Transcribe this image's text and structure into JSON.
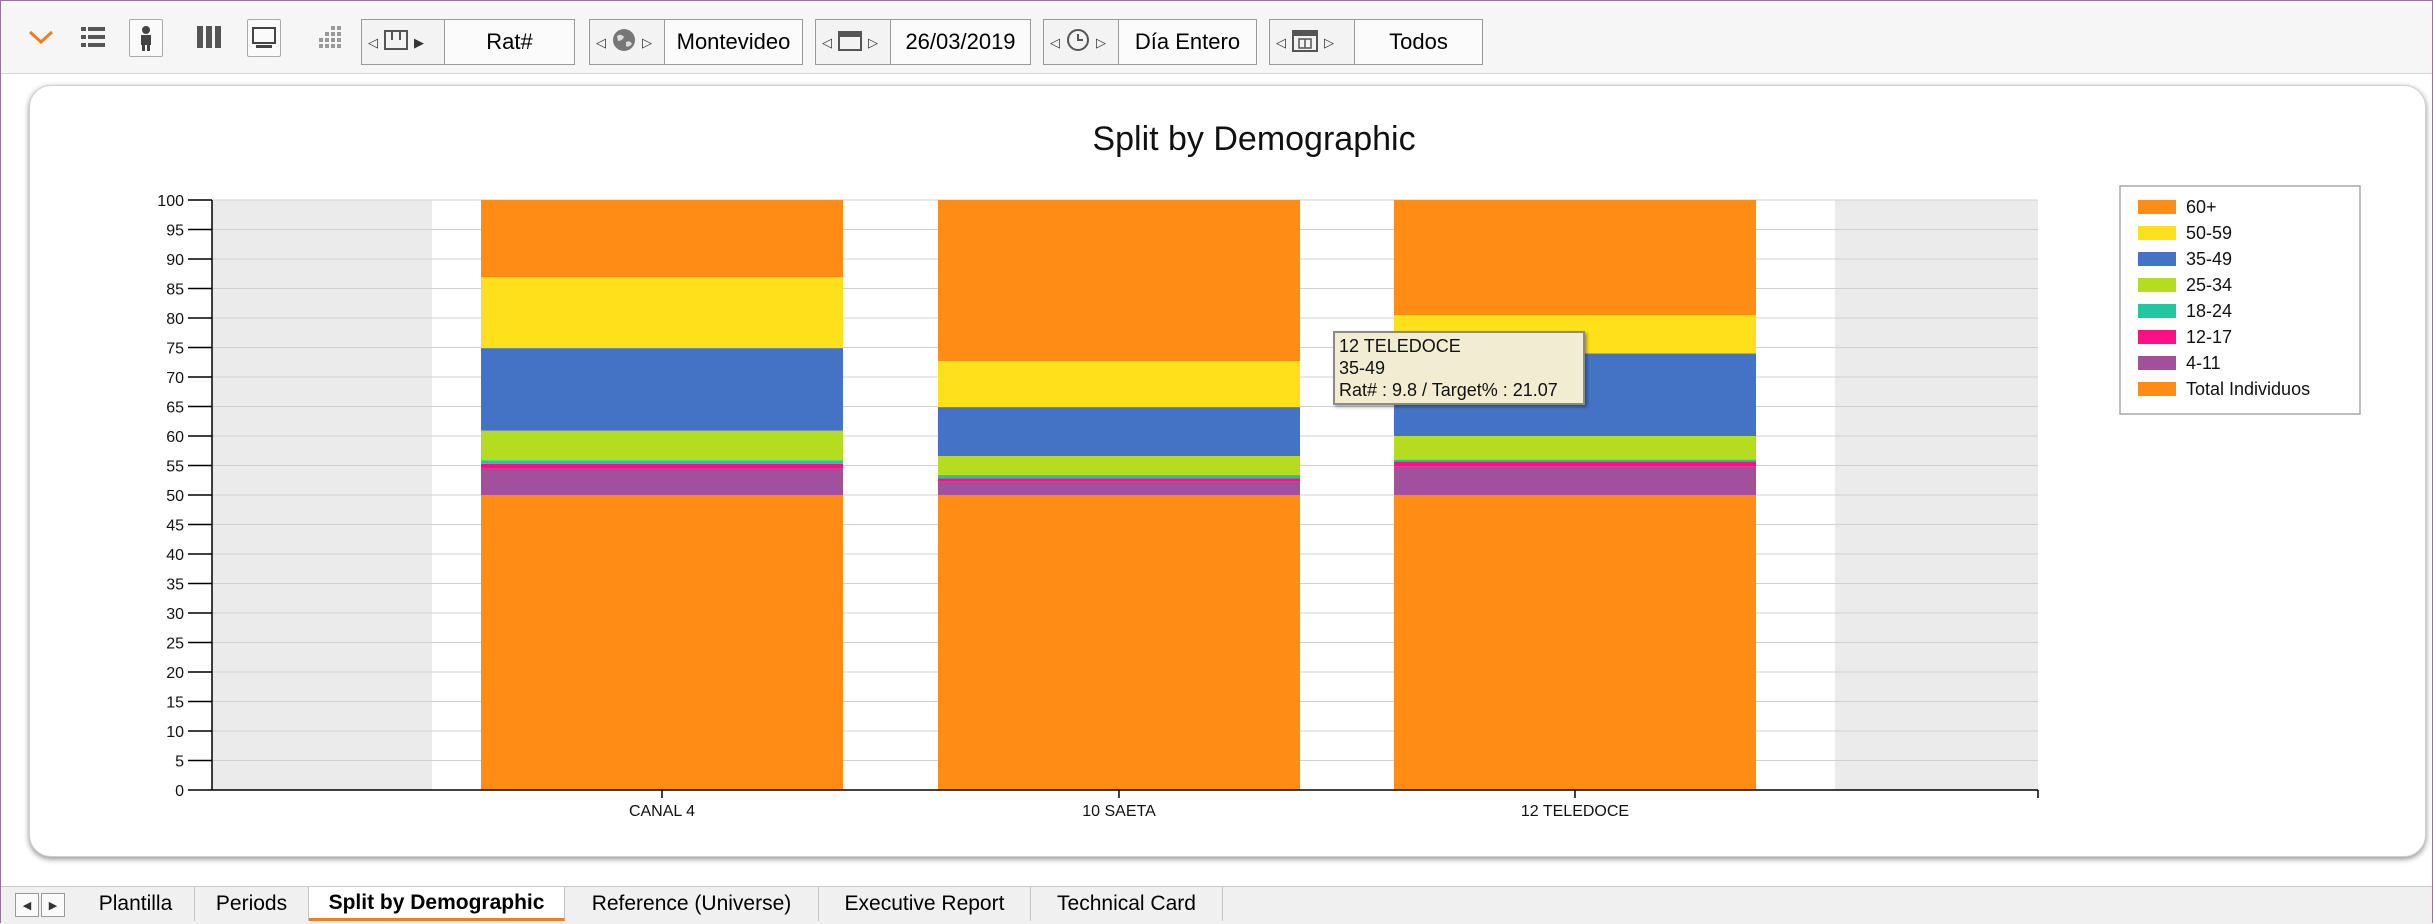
{
  "toolbar": {
    "filters": [
      {
        "name": "measure",
        "value": "Rat#",
        "icon": "columns-icon"
      },
      {
        "name": "region",
        "value": "Montevideo",
        "icon": "globe-icon"
      },
      {
        "name": "date",
        "value": "26/03/2019",
        "icon": "calendar-icon"
      },
      {
        "name": "time",
        "value": "Día Entero",
        "icon": "clock-icon"
      },
      {
        "name": "days",
        "value": "Todos",
        "icon": "calendar-grid-icon"
      }
    ]
  },
  "chart_data": {
    "type": "bar",
    "stacked": true,
    "title": "Split by Demographic",
    "categories": [
      "CANAL 4",
      "10 SAETA",
      "12 TELEDOCE"
    ],
    "ylim": [
      0,
      100
    ],
    "yticks": [
      0,
      5,
      10,
      15,
      20,
      25,
      30,
      35,
      40,
      45,
      50,
      55,
      60,
      65,
      70,
      75,
      80,
      85,
      90,
      95,
      100
    ],
    "grid": true,
    "legend_position": "top-right",
    "series": [
      {
        "name": "Total Individuos",
        "color": "#ff8c14",
        "values": [
          50,
          50,
          50
        ]
      },
      {
        "name": "4-11",
        "color": "#a3509c",
        "values": [
          4.5,
          2.3,
          4.8
        ]
      },
      {
        "name": "12-17",
        "color": "#ff0f87",
        "values": [
          0.8,
          0.5,
          0.9
        ]
      },
      {
        "name": "18-24",
        "color": "#22c7a0",
        "values": [
          0.6,
          0.6,
          0.3
        ]
      },
      {
        "name": "25-34",
        "color": "#b5dc1e",
        "values": [
          5.0,
          3.2,
          4.0
        ]
      },
      {
        "name": "35-49",
        "color": "#4472c4",
        "values": [
          14.0,
          8.3,
          14.0
        ]
      },
      {
        "name": "50-59",
        "color": "#ffe01a",
        "values": [
          12.0,
          7.8,
          6.5
        ]
      },
      {
        "name": "60+",
        "color": "#ff8c14",
        "values": [
          13.1,
          27.3,
          19.5
        ]
      }
    ],
    "legend_order": [
      "60+",
      "50-59",
      "35-49",
      "25-34",
      "18-24",
      "12-17",
      "4-11",
      "Total Individuos"
    ]
  },
  "tooltip": {
    "line1": "12  TELEDOCE",
    "line2": "35-49",
    "line3": "Rat# : 9.8 / Target% : 21.07"
  },
  "tabs": [
    {
      "label": "Plantilla",
      "active": false
    },
    {
      "label": "Periods",
      "active": false
    },
    {
      "label": "Split by Demographic",
      "active": true
    },
    {
      "label": "Reference (Universe)",
      "active": false
    },
    {
      "label": "Executive Report",
      "active": false
    },
    {
      "label": "Technical Card",
      "active": false
    }
  ],
  "colors": {
    "accent": "#f07d1e",
    "plot_bg": "#ebebeb"
  }
}
